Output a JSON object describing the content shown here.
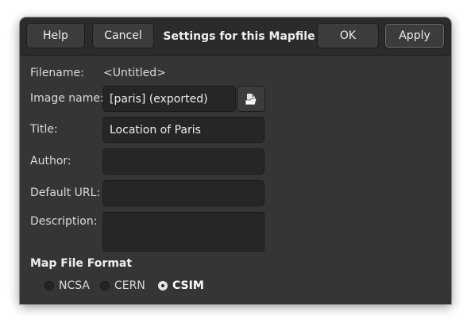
{
  "header": {
    "help_label": "Help",
    "cancel_label": "Cancel",
    "title": "Settings for this Mapfile",
    "ok_label": "OK",
    "apply_label": "Apply"
  },
  "form": {
    "filename_label": "Filename:",
    "filename_value": "<Untitled>",
    "image_name_label": "Image name:",
    "image_name_value": "[paris] (exported)",
    "title_label": "Title:",
    "title_value": "Location of Paris",
    "author_label": "Author:",
    "author_value": "",
    "default_url_label": "Default URL:",
    "default_url_value": "",
    "description_label": "Description:",
    "description_value": ""
  },
  "format": {
    "section_title": "Map File Format",
    "options": [
      {
        "label": "NCSA",
        "selected": false
      },
      {
        "label": "CERN",
        "selected": false
      },
      {
        "label": "CSIM",
        "selected": true
      }
    ]
  },
  "icons": {
    "browse": "open-file-icon"
  },
  "colors": {
    "dialog_bg": "#353535",
    "header_bg": "#2b2b2b",
    "entry_bg": "#262626"
  }
}
